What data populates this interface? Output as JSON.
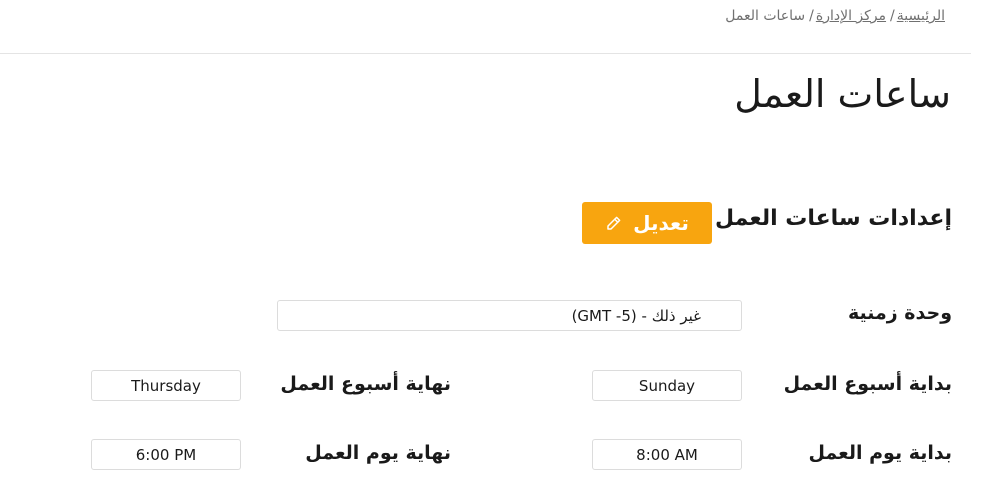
{
  "breadcrumb": {
    "home": "الرئيسية",
    "admin": "مركز الإدارة",
    "current": "ساعات العمل",
    "separator": "/"
  },
  "page": {
    "title": "ساعات العمل"
  },
  "section": {
    "title": "إعدادات ساعات العمل",
    "edit_label": "تعديل",
    "edit_icon": "pencil-icon"
  },
  "fields": {
    "timezone": {
      "label": "وحدة زمنية",
      "value": "(GMT -5) - غير ذلك"
    },
    "week_start": {
      "label": "بداية أسبوع العمل",
      "value": "Sunday"
    },
    "week_end": {
      "label": "نهاية أسبوع العمل",
      "value": "Thursday"
    },
    "day_start": {
      "label": "بداية يوم العمل",
      "value": "8:00 AM"
    },
    "day_end": {
      "label": "نهاية يوم العمل",
      "value": "6:00 PM"
    }
  },
  "colors": {
    "accent": "#f8a50f",
    "text": "#1a1a1a",
    "muted": "#707070",
    "border": "#dcdcdc"
  }
}
